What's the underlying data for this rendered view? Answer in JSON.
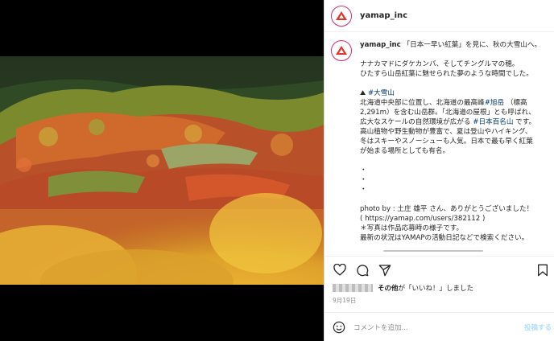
{
  "post": {
    "username": "yamap_inc",
    "avatar_text": "YAMAP",
    "caption": {
      "username": "yamap_inc",
      "title": "「日本一早い紅葉」を見に、秋の大雪山へ。",
      "intro_1": "ナナカマドにダケカンバ、そしてチングルマの穂。",
      "intro_2": "ひたすら山岳紅葉に魅せられた夢のような時間でした。",
      "place_icon": "⛰",
      "place_tag": "#大雪山",
      "desc_1a": "北海道中央部に位置し、北海道の最高峰",
      "desc_1tag": "#旭岳",
      "desc_1b": "（標高",
      "desc_2": "2,291m）を含む山岳群。「北海道の屋根」とも呼ばれ、",
      "desc_3a": "広大なスケールの自然環境が広がる",
      "desc_3tag": "#日本百名山",
      "desc_3b": "です。",
      "desc_4": "高山植物や野生動物が豊富で、夏は登山やハイキング、",
      "desc_5": "冬はスキーやスノーシューも人気。日本で最も早く紅葉",
      "desc_6": "が始まる場所としても有名。",
      "dot": "・",
      "credit_1": "photo by : 土庄 雄平 さん、ありがとうございました！",
      "credit_2": "( https://yamap.com/users/382112 )",
      "credit_3": "＊写真は作品応募時の様子です。",
      "credit_4": "最新の状況はYAMAPの活動日記などで検索ください。"
    },
    "likes_text_bold": "その他",
    "likes_text": "が「いいね！」しました",
    "date": "9月19日",
    "comment_placeholder": "コメントを追加...",
    "post_button": "投稿する"
  },
  "colors": {
    "accent": "#d62976",
    "brand_red": "#e4322b",
    "link": "#00376b"
  },
  "icons": [
    "heart-icon",
    "comment-icon",
    "share-icon",
    "bookmark-icon",
    "emoji-icon",
    "mountain-icon"
  ]
}
